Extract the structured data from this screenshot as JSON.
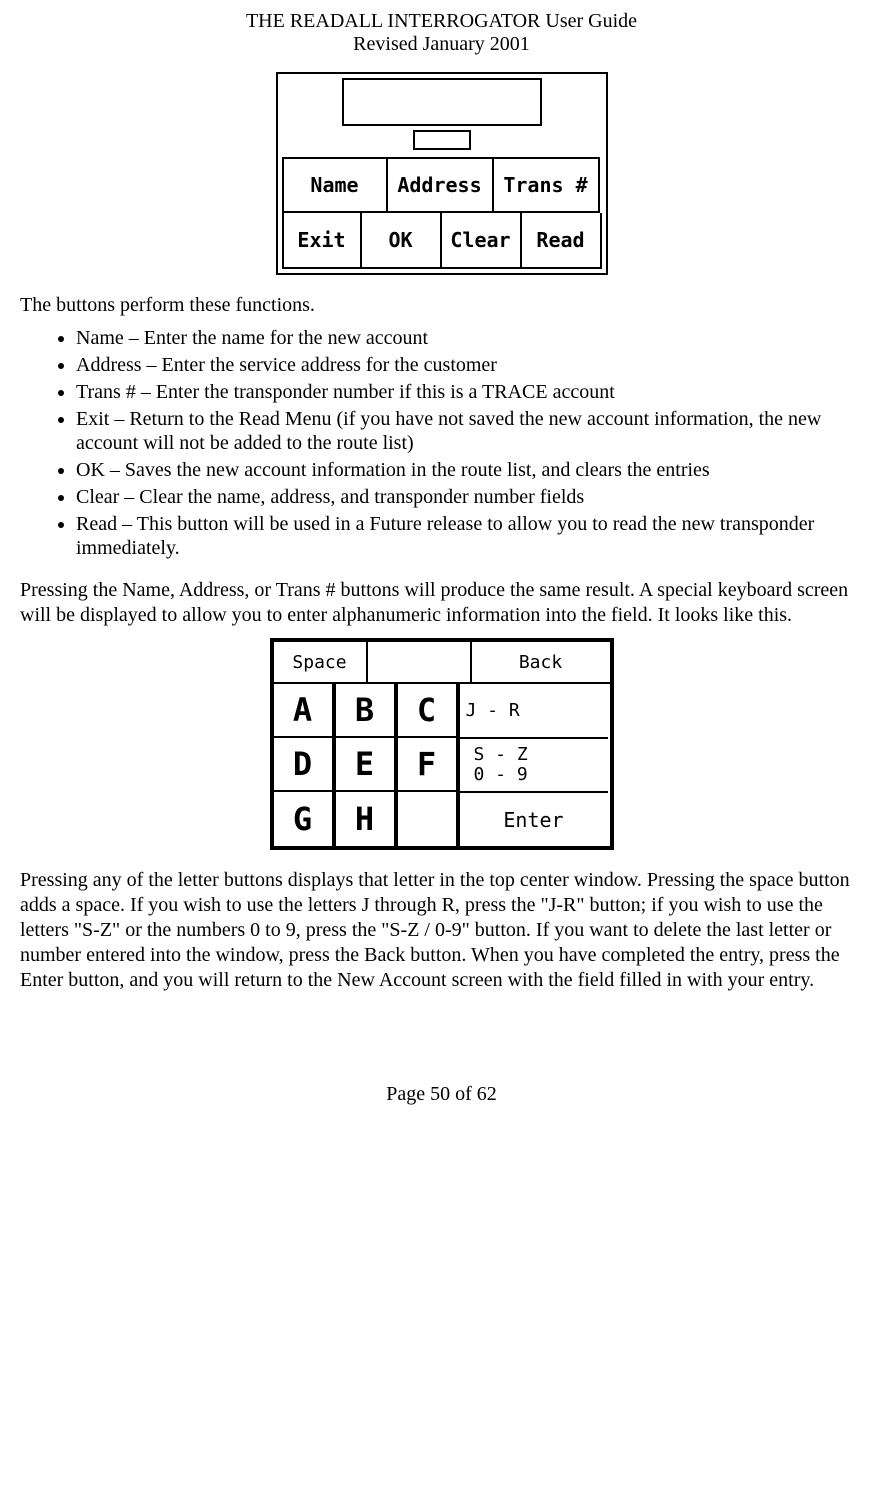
{
  "header": {
    "title": "THE READALL INTERROGATOR User Guide",
    "subtitle": "Revised January 2001"
  },
  "screen1": {
    "row1": [
      "Name",
      "Address",
      "Trans #"
    ],
    "row2": [
      "Exit",
      "OK",
      "Clear",
      "Read"
    ]
  },
  "intro": "The buttons perform these functions.",
  "bullets": [
    "Name – Enter the name for the new account",
    "Address – Enter the service address for the customer",
    "Trans # – Enter the transponder number if this is a TRACE account",
    "Exit – Return to the Read Menu (if you have not saved the new account information, the new account will not be added to the route list)",
    "OK – Saves the new account information in the route list, and clears the entries",
    "Clear – Clear the name, address, and transponder number fields",
    "Read – This button will be used in a Future release to allow you to read the new transponder immediately."
  ],
  "para2": "Pressing the Name, Address, or Trans # buttons will produce the same result.  A special keyboard screen will be displayed to allow you to enter alphanumeric information into the field.  It looks like this.",
  "screen2": {
    "top": {
      "space": "Space",
      "back": "Back"
    },
    "letters": [
      [
        "A",
        "B",
        "C"
      ],
      [
        "D",
        "E",
        "F"
      ],
      [
        "G",
        "H",
        ""
      ]
    ],
    "side": {
      "jr": "J - R",
      "sz": "S - Z",
      "num": "0 - 9",
      "enter": "Enter"
    }
  },
  "para3": "Pressing any of the letter buttons displays that letter in the top center window.  Pressing the space button adds a space.  If you wish to use the letters J through R, press the \"J-R\" button; if you wish to use the letters \"S-Z\" or the numbers 0 to 9, press the \"S-Z / 0-9\" button.  If you want to delete the last letter or number entered into the window, press the Back button.  When you have completed the entry, press the Enter button, and you will return to the New Account screen with the field filled in with your entry.",
  "footer": "Page 50 of 62"
}
